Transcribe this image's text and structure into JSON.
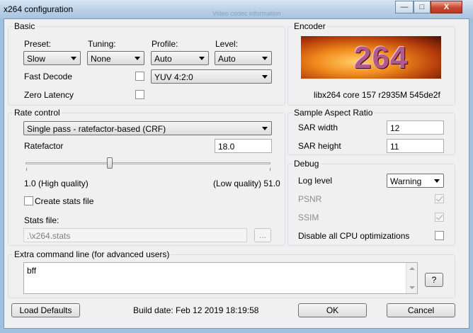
{
  "window": {
    "title": "x264 configuration",
    "background_title": "Video codec information",
    "controls": {
      "minimize": "—",
      "maximize": "□",
      "close": "X"
    }
  },
  "basic": {
    "group_label": "Basic",
    "preset": {
      "label": "Preset:",
      "value": "Slow"
    },
    "tuning": {
      "label": "Tuning:",
      "value": "None"
    },
    "profile": {
      "label": "Profile:",
      "value": "Auto"
    },
    "level": {
      "label": "Level:",
      "value": "Auto"
    },
    "fast_decode": {
      "label": "Fast Decode",
      "checked": false
    },
    "zero_latency": {
      "label": "Zero Latency",
      "checked": false
    },
    "colorspace": {
      "value": "YUV 4:2:0"
    }
  },
  "encoder": {
    "group_label": "Encoder",
    "logo_text": "264",
    "version": "libx264 core 157 r2935M 545de2f"
  },
  "rate_control": {
    "group_label": "Rate control",
    "mode": "Single pass - ratefactor-based (CRF)",
    "ratefactor_label": "Ratefactor",
    "ratefactor_value": "18.0",
    "slider_fraction": 0.34,
    "min_label": "1.0 (High quality)",
    "max_label": "(Low quality) 51.0",
    "create_stats": {
      "label": "Create stats file",
      "checked": false
    },
    "stats_file_label": "Stats file:",
    "stats_file_value": ".\\x264.stats",
    "browse_label": "..."
  },
  "sar": {
    "group_label": "Sample Aspect Ratio",
    "width_label": "SAR width",
    "width_value": "12",
    "height_label": "SAR height",
    "height_value": "11"
  },
  "debug": {
    "group_label": "Debug",
    "log_level_label": "Log level",
    "log_level_value": "Warning",
    "psnr": {
      "label": "PSNR",
      "checked": true
    },
    "ssim": {
      "label": "SSIM",
      "checked": true
    },
    "disable_cpu": {
      "label": "Disable all CPU optimizations",
      "checked": false
    }
  },
  "extra": {
    "group_label": "Extra command line (for advanced users)",
    "value": "bff",
    "help_label": "?"
  },
  "footer": {
    "load_defaults": "Load Defaults",
    "build_date": "Build date: Feb 12 2019 18:19:58",
    "ok": "OK",
    "cancel": "Cancel"
  }
}
